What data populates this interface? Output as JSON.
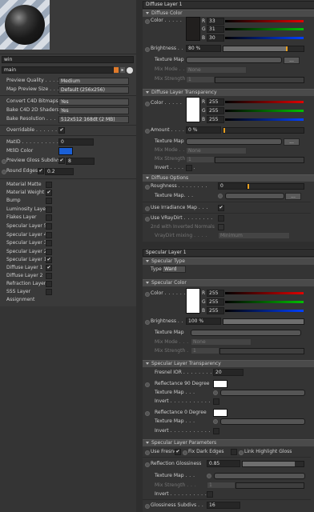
{
  "left": {
    "name_field": "win",
    "name_field2": "main",
    "rows": [
      {
        "label": "Preview Quality",
        "value": "Medium",
        "type": "dropdown"
      },
      {
        "label": "Map Preview Size",
        "value": "Default (256x256)",
        "type": "dropdown"
      },
      {
        "label": "Convert C4D Bitmaps",
        "value": "Yes",
        "type": "dropdown"
      },
      {
        "label": "Bake C4D 2D Shaders",
        "value": "Yes",
        "type": "dropdown"
      },
      {
        "label": "Bake Resolution",
        "value": "512x512 168dt (2 MB)",
        "type": "dropdown"
      }
    ],
    "overridable": {
      "label": "Overridable",
      "checked": "✔"
    },
    "matid": {
      "label": "MatID",
      "value": "0"
    },
    "mtlid_color": {
      "label": "MtlID Color",
      "color": "#1a5fd6"
    },
    "preview_gloss": {
      "label": "Preview Gloss Subdivs",
      "check": "✔",
      "value": "8"
    },
    "round_edges": {
      "label": "Round Edges",
      "check": "✔",
      "value": "0.2"
    },
    "layers": [
      {
        "label": "Material Matte",
        "checked": ""
      },
      {
        "label": "Material Weight",
        "checked": "✔"
      },
      {
        "label": "Bump",
        "checked": ""
      },
      {
        "label": "Luminosity Layer",
        "checked": ""
      },
      {
        "label": "Flakes Layer",
        "checked": ""
      },
      {
        "label": "Specular Layer 5",
        "checked": ""
      },
      {
        "label": "Specular Layer 4",
        "checked": ""
      },
      {
        "label": "Specular Layer 3",
        "checked": ""
      },
      {
        "label": "Specular Layer 2",
        "checked": ""
      },
      {
        "label": "Specular Layer 1",
        "checked": "✔"
      },
      {
        "label": "Diffuse Layer 1",
        "checked": "✔"
      },
      {
        "label": "Diffuse Layer 2",
        "checked": ""
      },
      {
        "label": "Refraction Layer",
        "checked": ""
      },
      {
        "label": "SSS Layer",
        "checked": ""
      }
    ],
    "assignment": "Assignment"
  },
  "diffuse": {
    "title": "Diffuse Layer 1",
    "color_head": "Diffuse Color",
    "color_label": "Color",
    "r_label": "R",
    "g_label": "G",
    "b_label": "B",
    "r": "33",
    "g": "31",
    "b": "30",
    "swatch_color": "#211f1e",
    "brightness_label": "Brightness",
    "brightness": "80 %",
    "brightness_frac": 0.8,
    "texture_map": "Texture Map",
    "mix_mode": "Mix Mode",
    "mix_mode_value": "None",
    "mix_strength": "Mix Strength",
    "mix_strength_value": "1",
    "transp_head": "Diffuse Layer Transparency",
    "t_r": "255",
    "t_g": "255",
    "t_b": "255",
    "t_swatch": "#ffffff",
    "amount_label": "Amount",
    "amount": "0 %",
    "invert": "Invert",
    "options_head": "Diffuse Options",
    "roughness_label": "Roughness",
    "roughness": "0",
    "use_irradiance": "Use Irradiance Map",
    "use_vraydirt": "Use VRayDirt",
    "second_inverted": "2nd with Inverted Normals",
    "vraydirt_mixing": "VrayDirt mixing",
    "vraydirt_mixing_value": "Minimum"
  },
  "specular": {
    "title": "Specular Layer 1",
    "type_head": "Specular Type",
    "type_label": "Type",
    "type_value": "Ward",
    "color_head": "Specular Color",
    "color_label": "Color",
    "r": "255",
    "g": "255",
    "b": "255",
    "swatch_color": "#ffffff",
    "brightness_label": "Brightness",
    "brightness": "100 %",
    "brightness_frac": 1.0,
    "texture_map": "Texture Map",
    "mix_mode": "Mix Mode",
    "mix_mode_value": "None",
    "mix_strength": "Mix Strength",
    "mix_strength_value": "1",
    "transp_head": "Specular Layer Transparency",
    "fresnel_ior_label": "Fresnel IOR",
    "fresnel_ior": "20",
    "refl90_label": "Reflectance 90 Degree",
    "refl0_label": "Reflectance  0 Degree",
    "invert": "Invert",
    "params_head": "Specular Layer Parameters",
    "use_fresnel": "Use Fresnel",
    "fix_dark": "Fix Dark Edges",
    "link_highlight": "Link Highlight Gloss",
    "refl_gloss_label": "Reflection Glossiness",
    "refl_gloss": "0.85",
    "gloss_subdivs_label": "Glossiness Subdivs",
    "gloss_subdivs": "16"
  }
}
